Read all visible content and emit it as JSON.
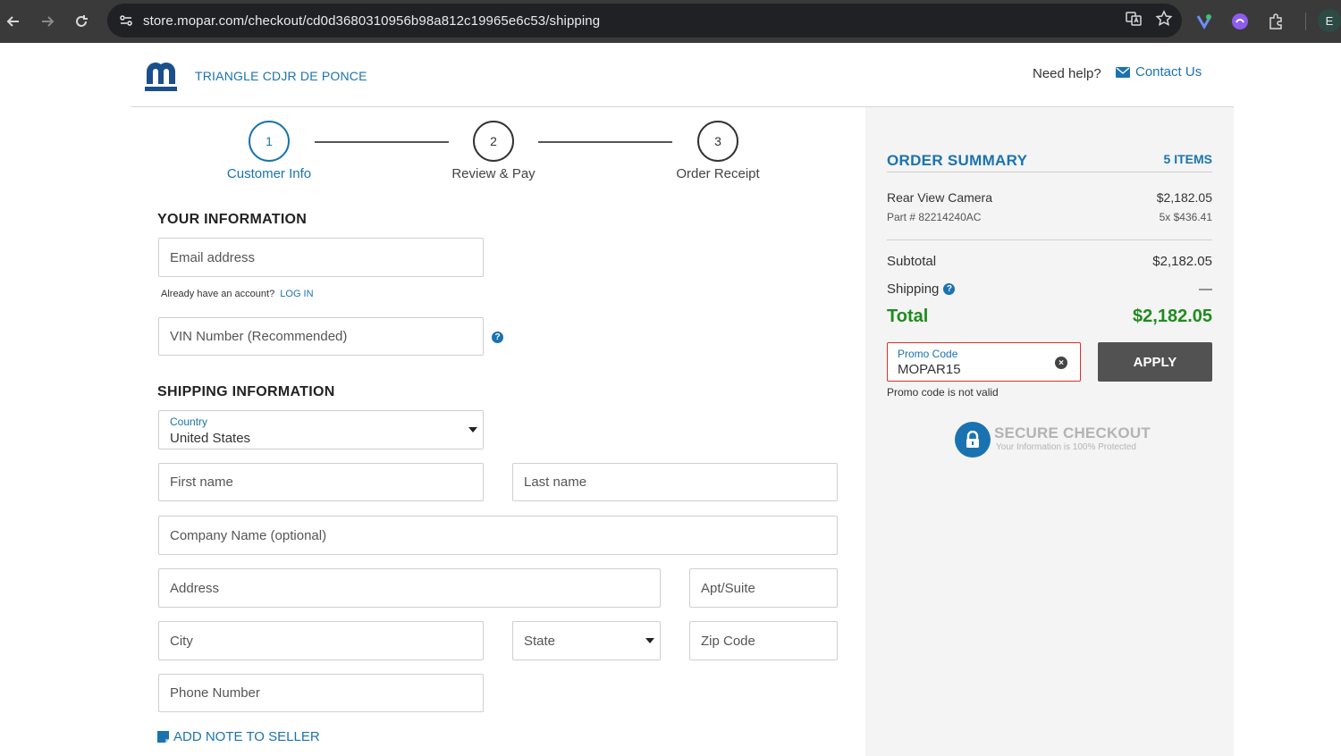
{
  "browser": {
    "url": "store.mopar.com/checkout/cd0d3680310956b98a812c19965e6c53/shipping",
    "profile_initial": "E"
  },
  "header": {
    "dealer_name": "TRIANGLE CDJR DE PONCE",
    "need_help": "Need help?",
    "contact_us": "Contact Us"
  },
  "steps": [
    {
      "number": "1",
      "label": "Customer Info",
      "active": true
    },
    {
      "number": "2",
      "label": "Review & Pay",
      "active": false
    },
    {
      "number": "3",
      "label": "Order Receipt",
      "active": false
    }
  ],
  "your_info": {
    "title": "YOUR INFORMATION",
    "email_placeholder": "Email address",
    "account_prompt": "Already have an account?",
    "login_link": "LOG IN",
    "vin_placeholder": "VIN Number (Recommended)",
    "help_glyph": "?"
  },
  "shipping": {
    "title": "SHIPPING INFORMATION",
    "country_label": "Country",
    "country_value": "United States",
    "first_name_placeholder": "First name",
    "last_name_placeholder": "Last name",
    "company_placeholder": "Company Name (optional)",
    "address_placeholder": "Address",
    "apt_placeholder": "Apt/Suite",
    "city_placeholder": "City",
    "state_placeholder": "State",
    "zip_placeholder": "Zip Code",
    "phone_placeholder": "Phone Number",
    "add_note": "ADD NOTE TO SELLER"
  },
  "summary": {
    "title": "ORDER SUMMARY",
    "items_count": "5 ITEMS",
    "item": {
      "name": "Rear View Camera",
      "price": "$2,182.05",
      "part": "Part # 82214240AC",
      "qty_price": "5x $436.41"
    },
    "subtotal_label": "Subtotal",
    "subtotal_value": "$2,182.05",
    "shipping_label": "Shipping",
    "shipping_value": "—",
    "total_label": "Total",
    "total_value": "$2,182.05",
    "promo_label": "Promo Code",
    "promo_value": "MOPAR15",
    "apply_label": "APPLY",
    "promo_error": "Promo code is not valid",
    "secure_title": "SECURE CHECKOUT",
    "secure_sub": "Your Information is 100% Protected"
  },
  "colors": {
    "brand_blue": "#1a73b0",
    "total_green": "#1e8c1e",
    "error_red": "#d93025",
    "button_gray": "#525252"
  }
}
